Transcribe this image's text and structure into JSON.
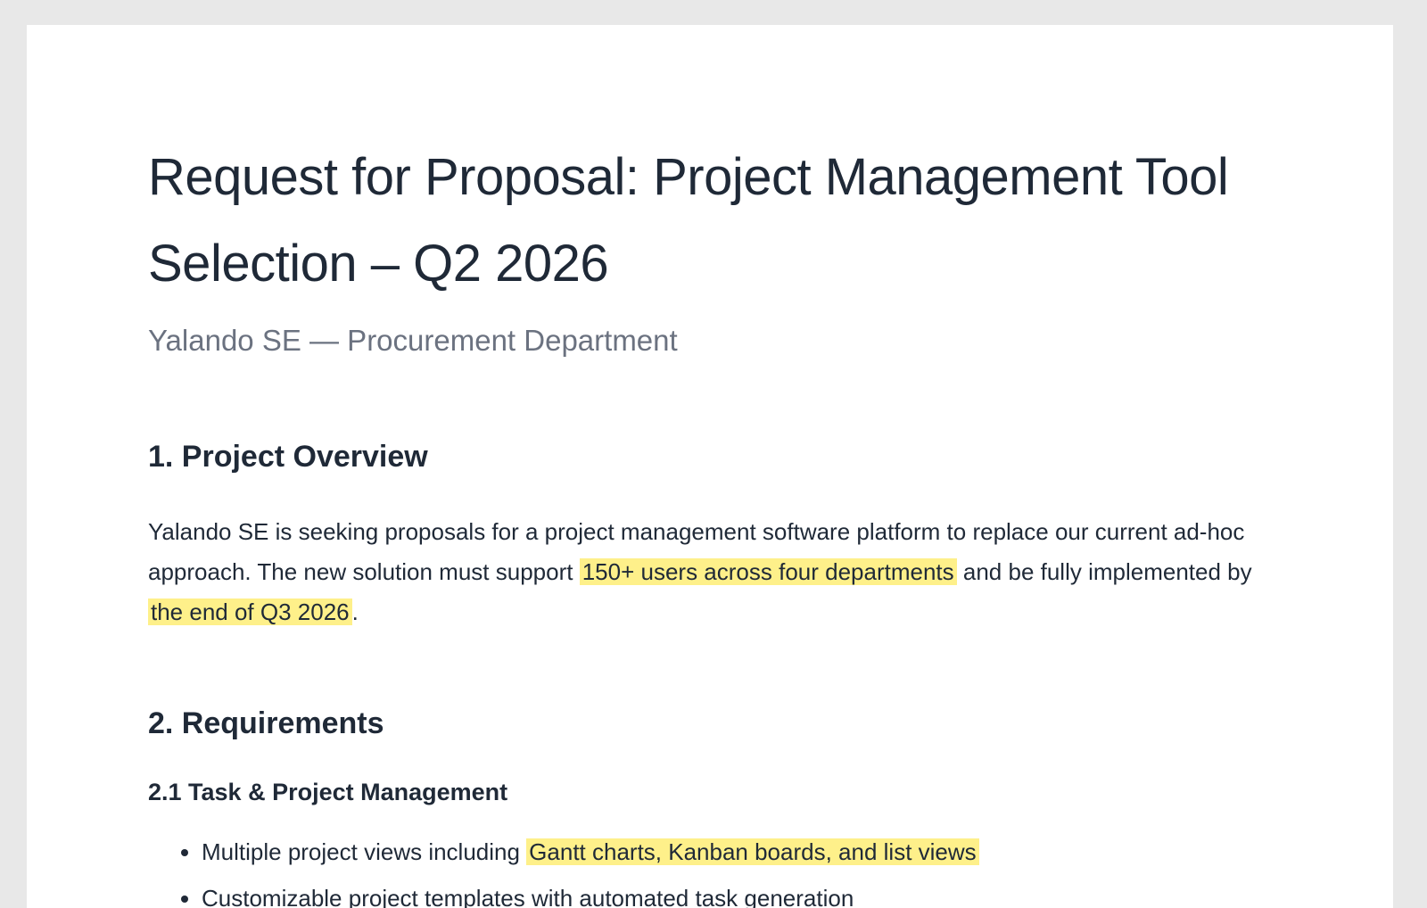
{
  "document": {
    "title": "Request for Proposal: Project Management Tool Selection – Q2 2026",
    "subtitle": "Yalando SE — Procurement Department",
    "sections": {
      "overview": {
        "heading": "1. Project Overview",
        "text_1": "Yalando SE is seeking proposals for a project management software platform to replace our current ad-hoc approach. The new solution must support ",
        "highlight_1": "150+ users across four departments",
        "text_2": " and be fully implemented by ",
        "highlight_2": "the end of Q3 2026",
        "text_3": "."
      },
      "requirements": {
        "heading": "2. Requirements",
        "subsection_1": {
          "heading": "2.1 Task & Project Management",
          "items": [
            {
              "text": "Multiple project views including ",
              "highlight": "Gantt charts, Kanban boards, and list views"
            },
            {
              "text": "Customizable project templates with automated task generation",
              "highlight": ""
            }
          ]
        }
      }
    }
  },
  "colors": {
    "highlight": "#fef08a",
    "text": "#1f2937",
    "muted": "#6b7280",
    "background": "#e8e8e8",
    "page": "#ffffff"
  }
}
